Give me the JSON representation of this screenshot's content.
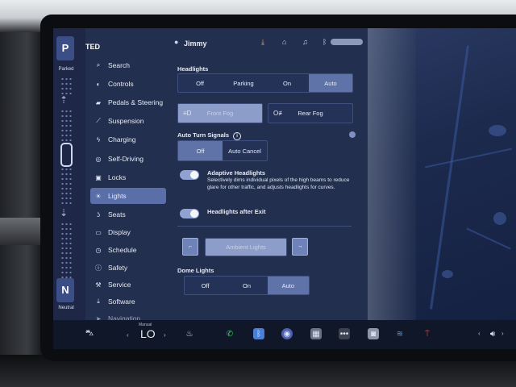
{
  "user": {
    "short": "TED",
    "name": "Jimmy"
  },
  "gear": {
    "top": "P",
    "top_label": "Parked",
    "bottom": "N",
    "bottom_label": "Neutral"
  },
  "menu": [
    {
      "label": "Search",
      "icon": "search-icon"
    },
    {
      "label": "Controls",
      "icon": "toggle-icon"
    },
    {
      "label": "Pedals & Steering",
      "icon": "car-icon"
    },
    {
      "label": "Suspension",
      "icon": "wrench-icon"
    },
    {
      "label": "Charging",
      "icon": "bolt-icon"
    },
    {
      "label": "Self-Driving",
      "icon": "steering-wheel-icon"
    },
    {
      "label": "Locks",
      "icon": "lock-icon"
    },
    {
      "label": "Lights",
      "icon": "sun-icon",
      "active": true
    },
    {
      "label": "Seats",
      "icon": "seat-icon"
    },
    {
      "label": "Display",
      "icon": "display-icon"
    },
    {
      "label": "Schedule",
      "icon": "clock-icon"
    },
    {
      "label": "Safety",
      "icon": "shield-icon"
    },
    {
      "label": "Service",
      "icon": "wrench-icon"
    },
    {
      "label": "Software",
      "icon": "download-icon"
    },
    {
      "label": "Navigation",
      "icon": "navigation-icon"
    }
  ],
  "headlights": {
    "title": "Headlights",
    "options": [
      "Off",
      "Parking",
      "On",
      "Auto"
    ],
    "selected": "Auto",
    "front_fog": "Front Fog",
    "rear_fog": "Rear Fog"
  },
  "turn_signals": {
    "title": "Auto Turn Signals",
    "options": [
      "Off",
      "Auto Cancel"
    ],
    "selected": "Off"
  },
  "adaptive": {
    "title": "Adaptive Headlights",
    "description": "Selectively dims individual pixels of the high beams to reduce glare for other traffic, and adjusts headlights for curves."
  },
  "after_exit": {
    "title": "Headlights after Exit"
  },
  "ambient": {
    "label": "Ambient Lights"
  },
  "dome": {
    "title": "Dome Lights",
    "options": [
      "Off",
      "On",
      "Auto"
    ],
    "selected": "Auto"
  },
  "dock": {
    "mode_label": "Manual",
    "value": "LO"
  },
  "colors": {
    "accent": "#5f73a8",
    "panel": "#232f4e",
    "active_menu": "#5a6ea8"
  }
}
